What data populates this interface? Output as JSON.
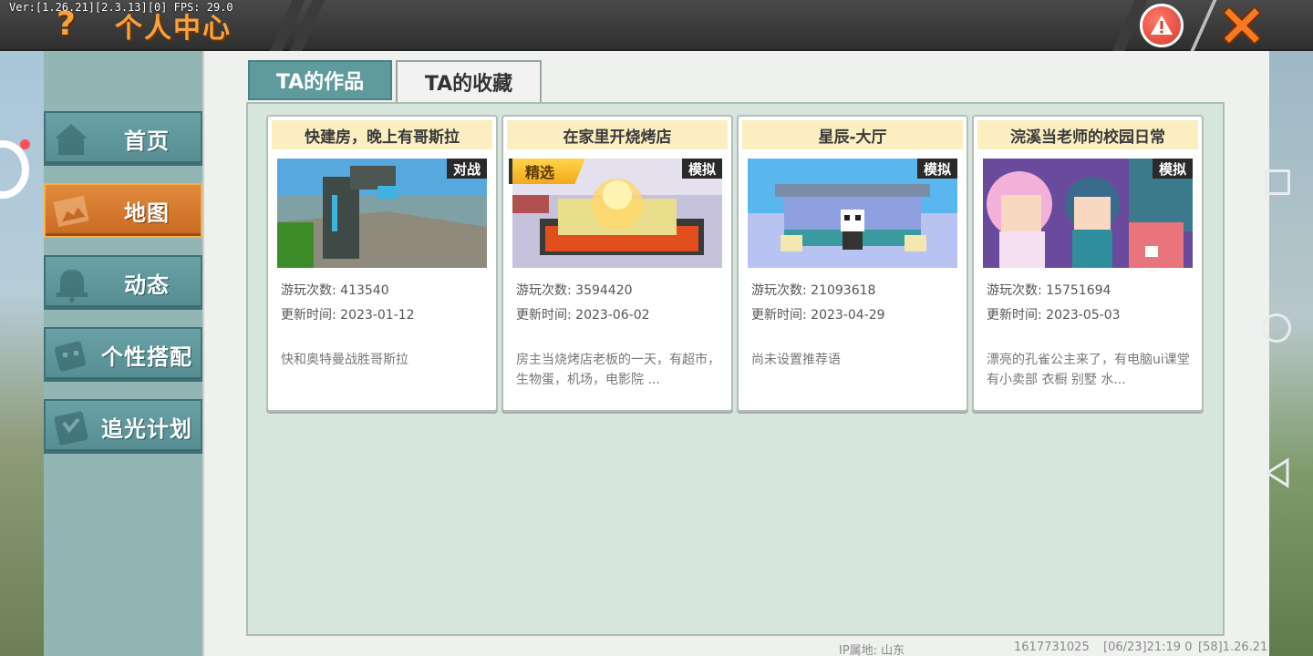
{
  "version_text": "Ver:[1.26.21][2.3.13][0] FPS: 29.0",
  "header": {
    "help_glyph": "?",
    "title": "个人中心"
  },
  "icons": {
    "help": "question-mark-icon",
    "report": "warning-icon",
    "close": "close-x-icon"
  },
  "colors": {
    "accent_orange": "#f7a23a",
    "nav_teal": "#6aa1a6",
    "nav_active": "#e08a3c",
    "card_title_bg": "#fbeec0",
    "badge_bg": "#2a2a2a"
  },
  "sidebar": {
    "items": [
      {
        "label": "首页",
        "icon": "home-icon",
        "active": false
      },
      {
        "label": "地图",
        "icon": "map-icon",
        "active": true
      },
      {
        "label": "动态",
        "icon": "bell-icon",
        "active": false
      },
      {
        "label": "个性搭配",
        "icon": "avatar-icon",
        "active": false
      },
      {
        "label": "追光计划",
        "icon": "plan-icon",
        "active": false
      }
    ]
  },
  "tabs": [
    {
      "label": "TA的作品",
      "active": true
    },
    {
      "label": "TA的收藏",
      "active": false
    }
  ],
  "cards": [
    {
      "title": "快建房，晚上有哥斯拉",
      "badge": "对战",
      "featured": "",
      "plays": "游玩次数: 413540",
      "updated": "更新时间: 2023-01-12",
      "description": "快和奥特曼战胜哥斯拉"
    },
    {
      "title": "在家里开烧烤店",
      "badge": "模拟",
      "featured": "精选",
      "plays": "游玩次数: 3594420",
      "updated": "更新时间: 2023-06-02",
      "description": "房主当烧烤店老板的一天，有超市，生物蛋，机场，电影院 ..."
    },
    {
      "title": "星辰-大厅",
      "badge": "模拟",
      "featured": "",
      "plays": "游玩次数: 21093618",
      "updated": "更新时间: 2023-04-29",
      "description": "尚未设置推荐语"
    },
    {
      "title": "浣溪当老师的校园日常",
      "badge": "模拟",
      "featured": "",
      "plays": "游玩次数: 15751694",
      "updated": "更新时间: 2023-05-03",
      "description": "漂亮的孔雀公主来了，有电脑ui课堂 有小卖部  衣橱 别墅 水..."
    }
  ],
  "footer": {
    "ip_location": "IP属地: 山东",
    "user_id": "1617731025",
    "timestamp": "[06/23]21:19 0",
    "build": "[58]1.26.21"
  }
}
